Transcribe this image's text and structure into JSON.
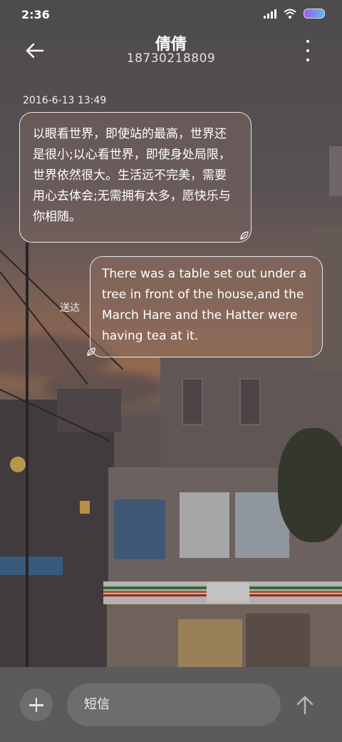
{
  "status_bar": {
    "time": "2:36",
    "icons": [
      "signal-icon",
      "wifi-icon",
      "battery-icon"
    ]
  },
  "header": {
    "contact_name": "倩倩",
    "phone_number": "18730218809",
    "back_icon": "back-arrow-icon",
    "more_icon": "more-vertical-icon"
  },
  "conversation": {
    "timestamp": "2016-6-13 13:49",
    "messages": [
      {
        "direction": "incoming",
        "text": "以眼看世界，即使站的最高，世界还是很小;以心看世界，即使身处局限，世界依然很大。生活远不完美，需要用心去体会;无需拥有太多，愿快乐与你相随。"
      },
      {
        "direction": "outgoing",
        "text": "There was a table set out under a tree in front of the house,and the March Hare and the Hatter were having tea at it.",
        "status": "送达"
      }
    ]
  },
  "composer": {
    "placeholder": "短信",
    "add_icon": "plus-icon",
    "send_icon": "send-arrow-icon"
  }
}
